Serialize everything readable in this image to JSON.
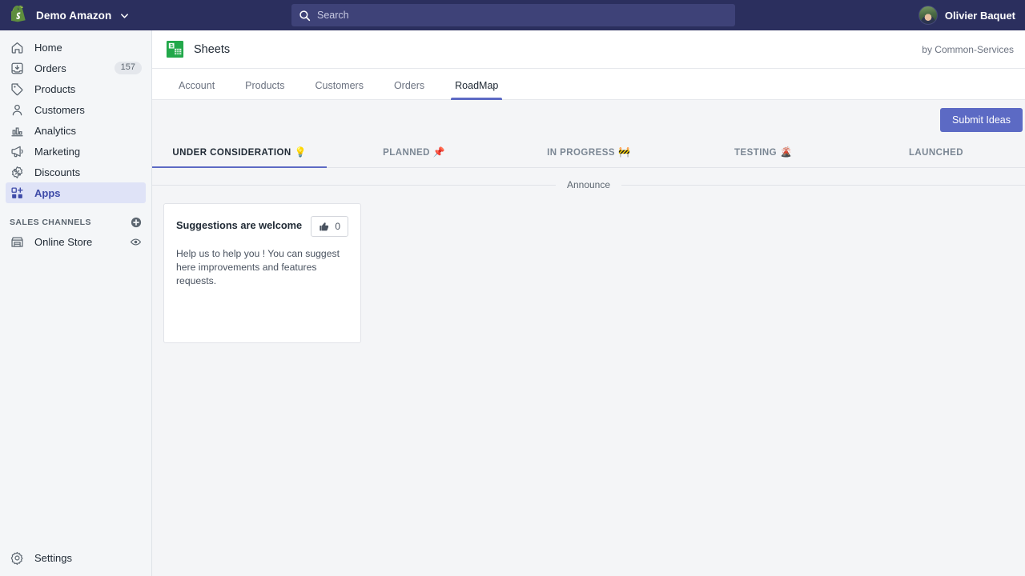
{
  "topbar": {
    "logo_icon": "shopify-bag-icon",
    "store_name": "Demo Amazon",
    "store_chevron_icon": "chevron-down-icon",
    "search": {
      "icon": "search-icon",
      "placeholder": "Search",
      "value": ""
    },
    "user": {
      "avatar_icon": "user-avatar",
      "name": "Olivier Baquet"
    },
    "bg_color": "#2b2f5e",
    "search_bg_color": "#3e4278"
  },
  "sidebar": {
    "items": [
      {
        "label": "Home",
        "icon": "home-icon",
        "badge": null,
        "active": false
      },
      {
        "label": "Orders",
        "icon": "orders-inbox-icon",
        "badge": "157",
        "active": false
      },
      {
        "label": "Products",
        "icon": "tag-icon",
        "badge": null,
        "active": false
      },
      {
        "label": "Customers",
        "icon": "person-icon",
        "badge": null,
        "active": false
      },
      {
        "label": "Analytics",
        "icon": "bar-chart-icon",
        "badge": null,
        "active": false
      },
      {
        "label": "Marketing",
        "icon": "megaphone-icon",
        "badge": null,
        "active": false
      },
      {
        "label": "Discounts",
        "icon": "discount-percent-icon",
        "badge": null,
        "active": false
      },
      {
        "label": "Apps",
        "icon": "apps-grid-plus-icon",
        "badge": null,
        "active": true
      }
    ],
    "sales_channels": {
      "title": "SALES CHANNELS",
      "add_icon": "plus-circle-icon",
      "items": [
        {
          "label": "Online Store",
          "icon": "storefront-icon",
          "trailing_icon": "eye-icon"
        }
      ]
    },
    "settings": {
      "label": "Settings",
      "icon": "gear-icon"
    },
    "active_bg_color": "#dfe3f7",
    "bg_color": "#f4f6f8"
  },
  "app": {
    "icon": "google-sheets-icon",
    "title": "Sheets",
    "by_line": "by Common-Services",
    "tabs": [
      {
        "label": "Account",
        "active": false
      },
      {
        "label": "Products",
        "active": false
      },
      {
        "label": "Customers",
        "active": false
      },
      {
        "label": "Orders",
        "active": false
      },
      {
        "label": "RoadMap",
        "active": true
      }
    ],
    "accent_color": "#5c6ac4"
  },
  "roadmap": {
    "submit_button": "Submit Ideas",
    "status_tabs": [
      {
        "label": "UNDER CONSIDERATION",
        "emoji": "💡",
        "active": true
      },
      {
        "label": "PLANNED",
        "emoji": "📌",
        "active": false
      },
      {
        "label": "IN PROGRESS",
        "emoji": "🚧",
        "active": false
      },
      {
        "label": "TESTING",
        "emoji": "🌋",
        "active": false
      },
      {
        "label": "LAUNCHED",
        "emoji": "",
        "active": false
      }
    ],
    "divider_label": "Announce",
    "cards": [
      {
        "title": "Suggestions are welcome",
        "vote_icon": "thumbs-up-icon",
        "vote_count": "0",
        "body": "Help us to help you ! You can suggest here improvements and features requests."
      }
    ]
  }
}
